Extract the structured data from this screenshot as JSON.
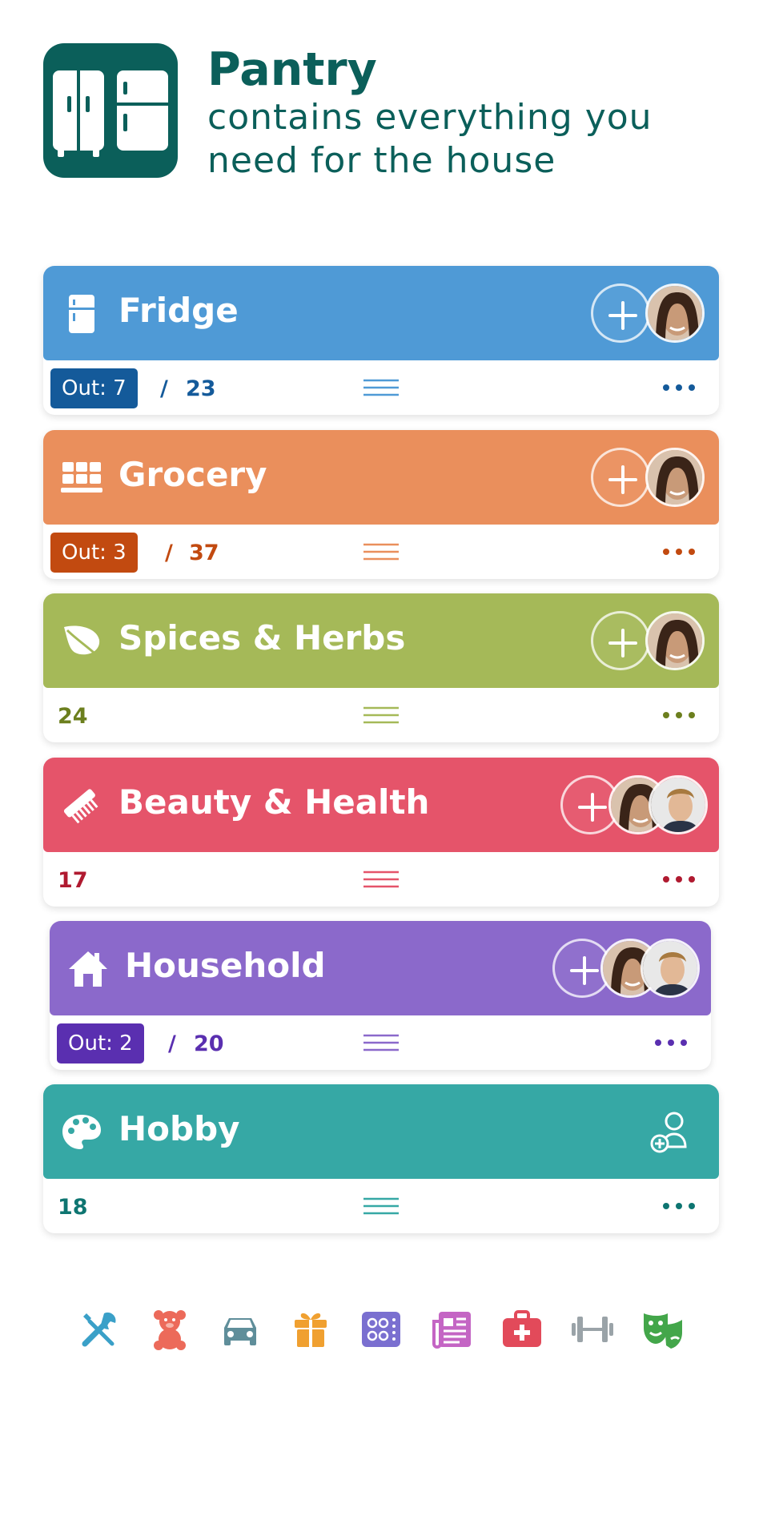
{
  "app": {
    "title": "Pantry",
    "subtitle": "contains everything you need for the house",
    "icon": "pantry-fridge-icon",
    "brand_color": "#0b5f5a"
  },
  "cards": [
    {
      "title": "Fridge",
      "icon": "fridge-icon",
      "color": "#4f9ad6",
      "dark": "#145a9a",
      "out_label": "Out: 7",
      "slash": "/",
      "total": "23",
      "members": [
        "avatar-woman"
      ]
    },
    {
      "title": "Grocery",
      "icon": "grocery-grid-icon",
      "color": "#ea8f5c",
      "dark": "#c24a10",
      "out_label": "Out: 3",
      "slash": "/",
      "total": "37",
      "members": [
        "avatar-woman"
      ]
    },
    {
      "title": "Spices & Herbs",
      "icon": "leaf-icon",
      "color": "#a5b958",
      "dark": "#6c7f1e",
      "count": "24",
      "members": [
        "avatar-woman"
      ]
    },
    {
      "title": "Beauty & Health",
      "icon": "comb-icon",
      "color": "#e5546a",
      "dark": "#b01a30",
      "count": "17",
      "members": [
        "avatar-woman",
        "avatar-man"
      ]
    },
    {
      "title": "Household",
      "icon": "house-icon",
      "color": "#8b69cb",
      "dark": "#5a2fb0",
      "out_label": "Out: 2",
      "slash": "/",
      "total": "20",
      "members": [
        "avatar-woman",
        "avatar-man"
      ]
    },
    {
      "title": "Hobby",
      "icon": "palette-icon",
      "color": "#36a8a5",
      "dark": "#0e7571",
      "count": "18",
      "members": []
    }
  ],
  "new_categories": [
    {
      "icon": "tools-icon",
      "color": "#3aa0c8"
    },
    {
      "icon": "teddy-bear-icon",
      "color": "#ec6a5a"
    },
    {
      "icon": "car-icon",
      "color": "#5f8e9a"
    },
    {
      "icon": "gift-icon",
      "color": "#f0a030"
    },
    {
      "icon": "stove-icon",
      "color": "#7a6fd0"
    },
    {
      "icon": "newspaper-icon",
      "color": "#c465c4"
    },
    {
      "icon": "first-aid-icon",
      "color": "#e24a5a"
    },
    {
      "icon": "dumbbell-icon",
      "color": "#9aa3a8"
    },
    {
      "icon": "theater-masks-icon",
      "color": "#43a64a"
    }
  ]
}
